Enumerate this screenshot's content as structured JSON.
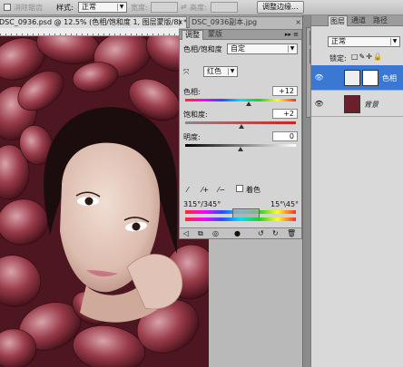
{
  "optbar": {
    "antialias_label": "消除锯齿",
    "style_label": "样式:",
    "style_value": "正常",
    "width_label": "宽度:",
    "height_label": "高度:",
    "refine_button": "调整边缘..."
  },
  "tabs": [
    {
      "label": "DSC_0936.psd @ 12.5% (色相/饱和度 1, 图层蒙版/8) *"
    },
    {
      "label": "DSC_0936副本.jpg"
    }
  ],
  "adjustments": {
    "tab_adjust": "调整",
    "tab_mask": "蒙版",
    "header_title": "色相/饱和度",
    "preset_value": "自定",
    "channel_value": "红色",
    "hue_label": "色相:",
    "hue_value": "+12",
    "hue_fraction": 0.57,
    "sat_label": "饱和度:",
    "sat_value": "+2",
    "sat_fraction": 0.51,
    "light_label": "明度:",
    "light_value": "0",
    "light_fraction": 0.5,
    "colorize_label": "着色",
    "range_left": "315°/345°",
    "range_right": "15°\\45°"
  },
  "layers_panel": {
    "tab_layers": "图层",
    "tab_channels": "通道",
    "tab_paths": "路径",
    "blend_mode": "正常",
    "lock_label": "锁定:",
    "layer1_name": "色相",
    "layer2_name": "背景"
  },
  "colors": {
    "selected_layer": "#3a78d4",
    "panel_bg": "#d4d4d4"
  }
}
